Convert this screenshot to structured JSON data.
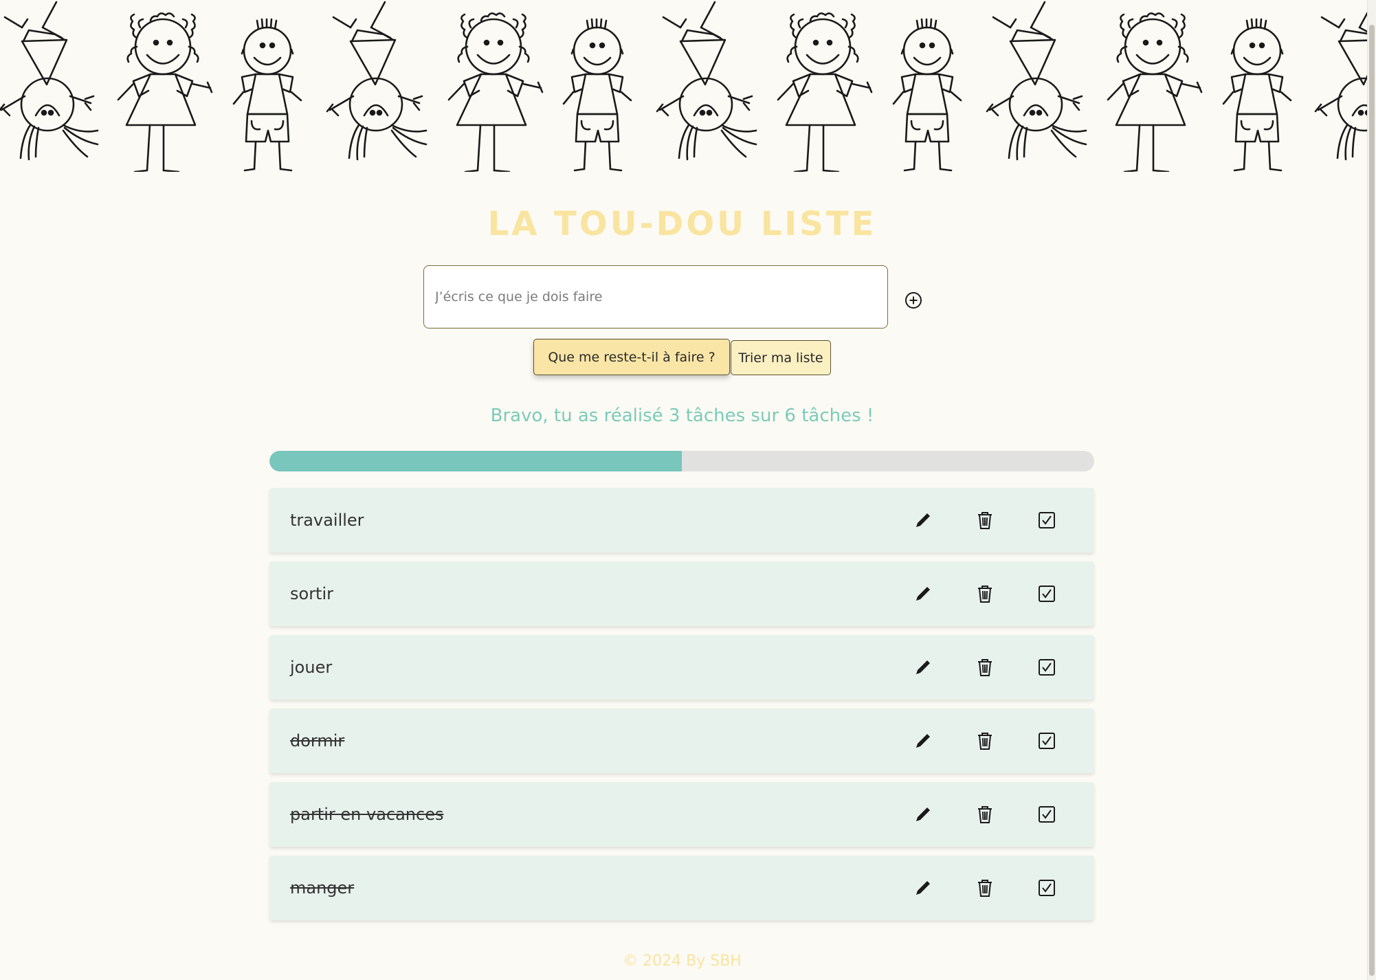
{
  "app": {
    "title": "LA TOU-DOU LISTE",
    "footer": "© 2024 By SBH"
  },
  "input": {
    "placeholder": "J’écris ce que je dois faire",
    "value": "",
    "add_icon": "plus-circle-icon"
  },
  "buttons": {
    "remaining_label": "Que me reste-t-il à faire ?",
    "sort_label": "Trier ma liste"
  },
  "progress": {
    "message": "Bravo, tu as réalisé 3 tâches sur 6 tâches !",
    "done": 3,
    "total": 6,
    "fraction": 0.5
  },
  "tasks": [
    {
      "label": "travailler",
      "done": false
    },
    {
      "label": "sortir",
      "done": false
    },
    {
      "label": "jouer",
      "done": false
    },
    {
      "label": "dormir",
      "done": true
    },
    {
      "label": "partir en vacances",
      "done": true
    },
    {
      "label": "manger",
      "done": true
    }
  ],
  "task_actions": {
    "edit_icon": "pencil-icon",
    "delete_icon": "trash-icon",
    "check_icon": "checkbox-icon"
  },
  "colors": {
    "background": "#fcfaf4",
    "title": "#f9e4a0",
    "accent": "#79c6bd",
    "progress_text": "#7bcbb8",
    "task_row": "#e8f2ec",
    "button": "#f9e5a6"
  }
}
